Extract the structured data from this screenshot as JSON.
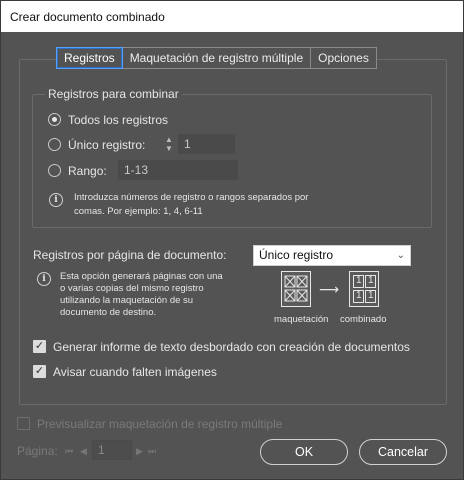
{
  "window": {
    "title": "Crear documento combinado"
  },
  "tabs": [
    {
      "label": "Registros",
      "active": true
    },
    {
      "label": "Maquetación de registro múltiple",
      "active": false
    },
    {
      "label": "Opciones",
      "active": false
    }
  ],
  "records_group": {
    "title": "Registros para combinar",
    "options": {
      "all": {
        "label": "Todos los registros",
        "selected": true
      },
      "single": {
        "label": "Único registro:",
        "value": "1",
        "selected": false
      },
      "range": {
        "label": "Rango:",
        "placeholder": "1-13",
        "selected": false
      }
    },
    "info_line1": "Introduzca números de registro o rangos separados por",
    "info_line2": "comas. Por ejemplo: 1, 4, 6-11"
  },
  "per_page": {
    "label": "Registros por página de documento:",
    "selected": "Único registro",
    "info_lines": [
      "Esta opción generará páginas con una",
      "o varias copias del mismo registro",
      "utilizando la maquetación de su",
      "documento de destino."
    ],
    "diagram_left_label": "maquetación",
    "diagram_right_label": "combinado",
    "cell_glyph": "1"
  },
  "checkboxes": {
    "overset_report": {
      "label": "Generar informe de texto desbordado con creación de documentos",
      "checked": true
    },
    "missing_images": {
      "label": "Avisar cuando falten imágenes",
      "checked": true
    }
  },
  "preview": {
    "label": "Previsualizar maquetación de registro múltiple",
    "checked": false,
    "enabled": false
  },
  "pager": {
    "label": "Página:",
    "value": "1"
  },
  "buttons": {
    "ok": "OK",
    "cancel": "Cancelar"
  },
  "colors": {
    "background": "#535353",
    "accent": "#55a0ff",
    "titlebar": "#ffffff"
  }
}
